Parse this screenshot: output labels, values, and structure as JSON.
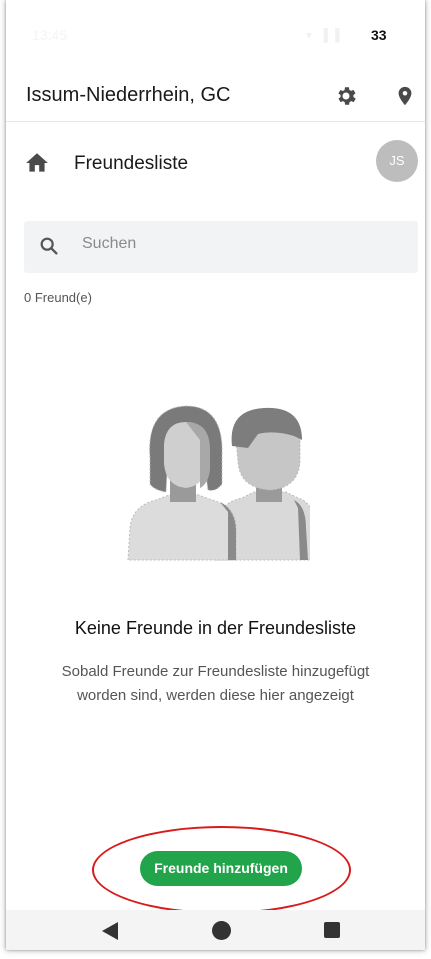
{
  "status_bar": {
    "time": "13:45",
    "battery": "33"
  },
  "app_bar": {
    "title": "Issum-Niederrhein, GC",
    "settings_icon": "gear-icon",
    "location_icon": "map-pin-icon"
  },
  "header": {
    "home_icon": "home-icon",
    "title": "Freundesliste",
    "avatar_initials": "JS"
  },
  "search": {
    "placeholder": "Suchen",
    "icon": "search-icon"
  },
  "friends": {
    "count_label": "0 Freund(e)",
    "items": []
  },
  "empty_state": {
    "illustration_icon": "people-icon",
    "title": "Keine Freunde in der Freundesliste",
    "description": "Sobald Freunde zur Freundesliste hinzugefügt worden sind, werden diese hier angezeigt"
  },
  "actions": {
    "add_friends_label": "Freunde hinzufügen"
  },
  "colors": {
    "accent": "#21a44a",
    "annotation": "#d91a1a",
    "avatar_bg": "#bdbdbd"
  },
  "nav_bar": {
    "back_icon": "back-icon",
    "home_icon": "home-circle-icon",
    "recents_icon": "recents-icon"
  }
}
